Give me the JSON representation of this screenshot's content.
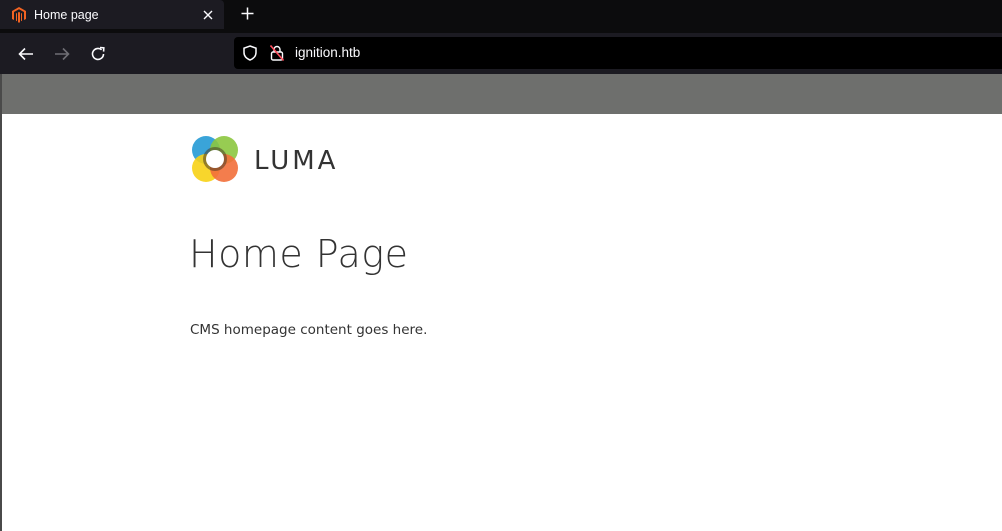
{
  "browser": {
    "tab": {
      "title": "Home page",
      "favicon": "magento-icon",
      "close_icon": "close-icon"
    },
    "new_tab_icon": "plus-icon",
    "nav": {
      "back_icon": "back-arrow-icon",
      "forward_icon": "forward-arrow-icon",
      "reload_icon": "reload-icon"
    },
    "urlbar": {
      "shield_icon": "shield-icon",
      "lock_icon": "insecure-lock-icon",
      "url": "ignition.htb"
    }
  },
  "page": {
    "logo": {
      "text": "LUMA",
      "icon": "luma-logo-icon"
    },
    "title": "Home Page",
    "content": "CMS homepage content goes here."
  },
  "colors": {
    "tab_bg": "#1c1b22",
    "toolbar_bg": "#1c1b22",
    "urlbar_bg": "#000000",
    "header_strip": "#6e6f6d",
    "text_dark": "#333333",
    "magento_orange": "#f26322"
  }
}
